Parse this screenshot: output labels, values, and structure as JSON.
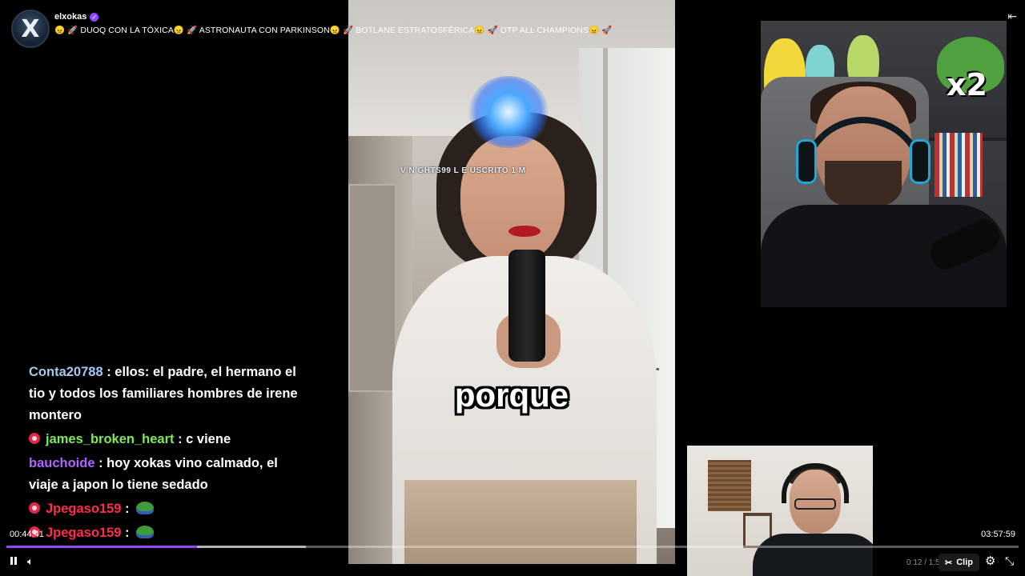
{
  "channel": {
    "name": "elxokas",
    "stream_title": "😠 🚀 DUOQ CON LA TÓXICA😠 🚀 ASTRONAUTA CON PARKINSON😠 🚀 BOTLANE ESTRATOSFÉRICA😠 🚀 OTP ALL CHAMPIONS😠 🚀"
  },
  "video": {
    "ticker": "V    N GHTS99 L  E    USCRITO  1  M",
    "caption": "porque"
  },
  "cam": {
    "overlay_text": "x2"
  },
  "chat": {
    "messages": [
      {
        "user": "Conta20788",
        "color": "#a8c8f0",
        "text": " : ellos: el padre, el hermano el tio y todos los familiares hombres de irene montero"
      },
      {
        "user": "james_broken_heart",
        "color": "#7dea5a",
        "text": " : c viene"
      },
      {
        "user": "bauchoide",
        "color": "#b064ff",
        "text": " : hoy xokas vino calmado, el viaje a japon lo tiene sedado"
      },
      {
        "user": "Jpegaso159",
        "color": "#ff2c4c",
        "text": " : "
      },
      {
        "user": "Jpegaso159",
        "color": "#ff2c4c",
        "text": " : "
      }
    ]
  },
  "player": {
    "current_time": "00:44:41",
    "total_time": "03:57:59",
    "progress_fraction": 0.188,
    "buffered_fraction": 0.296,
    "clip_time": "0:12 / 1:5",
    "clip_label": "Clip",
    "accent": "#9147ff"
  }
}
